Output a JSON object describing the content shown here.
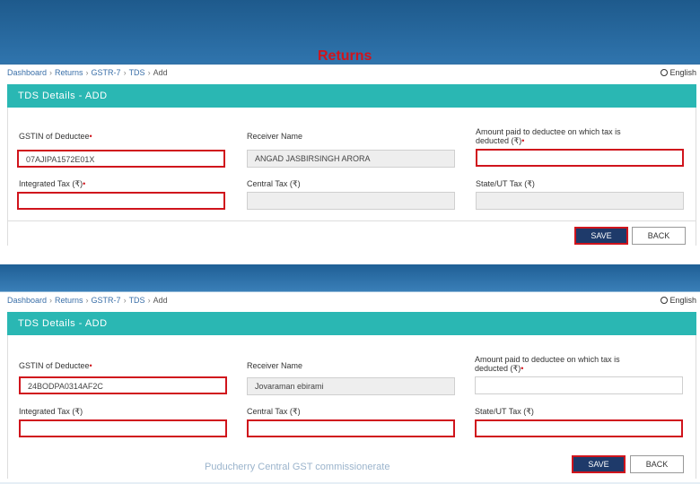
{
  "slide": {
    "title": "Returns",
    "footer": "Puducherry Central GST commissionerate"
  },
  "screens": [
    {
      "breadcrumb": [
        "Dashboard",
        "Returns",
        "GSTR-7",
        "TDS",
        "Add"
      ],
      "language": "English",
      "header": "TDS Details - ADD",
      "fields": {
        "gstin": {
          "label": "GSTIN of Deductee",
          "value": "07AJIPA1572E01X"
        },
        "receiver": {
          "label": "Receiver Name",
          "value": "ANGAD JASBIRSINGH ARORA"
        },
        "amount": {
          "label": "Amount paid to deductee on which tax is",
          "label2": "deducted (₹)",
          "value": ""
        },
        "igst": {
          "label": "Integrated Tax (₹)",
          "value": ""
        },
        "cgst": {
          "label": "Central Tax (₹)",
          "value": ""
        },
        "sgst": {
          "label": "State/UT Tax (₹)",
          "value": ""
        }
      },
      "save_label": "SAVE",
      "back_label": "BACK"
    },
    {
      "breadcrumb": [
        "Dashboard",
        "Returns",
        "GSTR-7",
        "TDS",
        "Add"
      ],
      "language": "English",
      "header": "TDS Details - ADD",
      "fields": {
        "gstin": {
          "label": "GSTIN of Deductee",
          "value": "24BODPA0314AF2C"
        },
        "receiver": {
          "label": "Receiver Name",
          "value": "Jovaraman ebirami"
        },
        "amount": {
          "label": "Amount paid to deductee on which tax is",
          "label2": "deducted (₹)",
          "value": ""
        },
        "igst": {
          "label": "Integrated Tax (₹)",
          "value": ""
        },
        "cgst": {
          "label": "Central Tax (₹)",
          "value": ""
        },
        "sgst": {
          "label": "State/UT Tax (₹)",
          "value": ""
        }
      },
      "save_label": "SAVE",
      "back_label": "BACK"
    }
  ],
  "colors": {
    "accent_teal": "#2ab7b3",
    "highlight_red": "#d0141c",
    "save_navy": "#1e3a6a"
  }
}
